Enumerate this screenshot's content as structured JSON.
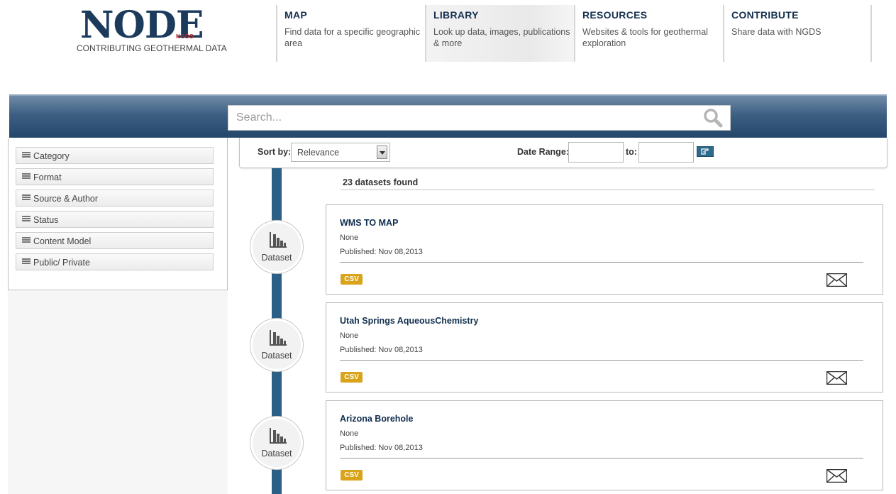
{
  "header": {
    "logo_word": "NODE",
    "logo_sub": "NGDS",
    "logo_tagline": "CONTRIBUTING GEOTHERMAL DATA",
    "nav": [
      {
        "title": "MAP",
        "desc": "Find data for a specific geographic area"
      },
      {
        "title": "LIBRARY",
        "desc": "Look up data, images, publications & more"
      },
      {
        "title": "RESOURCES",
        "desc": "Websites & tools for geothermal exploration"
      },
      {
        "title": "CONTRIBUTE",
        "desc": "Share data with NGDS"
      }
    ]
  },
  "search": {
    "placeholder": "Search..."
  },
  "sidebar": {
    "facets": [
      {
        "label": "Category"
      },
      {
        "label": "Format"
      },
      {
        "label": "Source & Author"
      },
      {
        "label": "Status"
      },
      {
        "label": "Content Model"
      },
      {
        "label": "Public/ Private"
      }
    ]
  },
  "sortbar": {
    "sort_label": "Sort by:",
    "sort_value": "Relevance",
    "date_label": "Date Range:",
    "to_label": "to:"
  },
  "results": {
    "count_text": "23 datasets found",
    "items": [
      {
        "type": "Dataset",
        "title": "WMS TO MAP",
        "desc": "None",
        "published": "Published: Nov 08,2013",
        "format": "CSV"
      },
      {
        "type": "Dataset",
        "title": "Utah Springs AqueousChemistry",
        "desc": "None",
        "published": "Published: Nov 08,2013",
        "format": "CSV"
      },
      {
        "type": "Dataset",
        "title": "Arizona Borehole",
        "desc": "None",
        "published": "Published: Nov 08,2013",
        "format": "CSV"
      }
    ]
  },
  "colors": {
    "brand_navy": "#1b3a5c",
    "timeline": "#2c5f85",
    "csv_badge": "#d9a41a"
  }
}
